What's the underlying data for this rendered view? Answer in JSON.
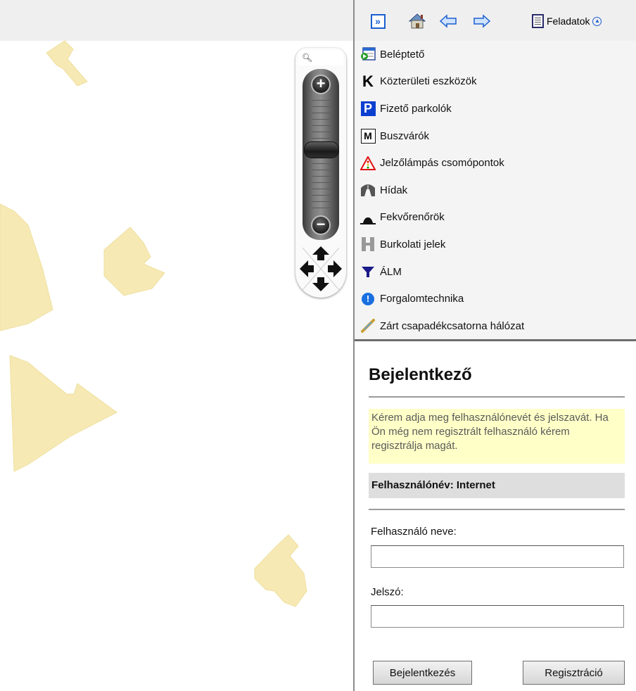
{
  "toolbar": {
    "expand_icon": "expand-double-arrow-icon",
    "home_icon": "home-icon",
    "back_icon": "arrow-left-icon",
    "forward_icon": "arrow-right-icon",
    "tasks_label": "Feladatok",
    "tasks_icon": "document-icon",
    "collapse_icon": "chevron-up-circle-icon"
  },
  "zoom": {
    "search_icon": "magnifier-icon",
    "zoom_in_icon": "plus-icon",
    "zoom_out_icon": "minus-icon",
    "level": 0.58
  },
  "layers": [
    {
      "label": "Beléptető",
      "icon": "entry-form-icon"
    },
    {
      "label": "Közterületi eszközök",
      "icon": "letter-k-icon"
    },
    {
      "label": "Fizető parkolók",
      "icon": "parking-icon"
    },
    {
      "label": "Buszvárók",
      "icon": "letter-m-icon"
    },
    {
      "label": "Jelzőlámpás csomópontok",
      "icon": "warning-triangle-icon"
    },
    {
      "label": "Hídak",
      "icon": "bridge-icon"
    },
    {
      "label": "Fekvőrenőrök",
      "icon": "speed-bump-icon"
    },
    {
      "label": "Burkolati jelek",
      "icon": "letter-h-icon"
    },
    {
      "label": "ÁLM",
      "icon": "funnel-icon"
    },
    {
      "label": "Forgalomtechnika",
      "icon": "info-icon"
    },
    {
      "label": "Zárt csapadékcsatorna hálózat",
      "icon": "pipe-icon"
    }
  ],
  "login": {
    "title": "Bejelentkező",
    "info": "Kérem adja meg felhasználónevét és jelszavát. Ha Ön még nem regisztrált felhasználó kérem regisztrálja magát.",
    "current_user": "Felhasználónév: Internet",
    "username_label": "Felhasználó neve:",
    "username_value": "",
    "password_label": "Jelszó:",
    "password_value": "",
    "login_button": "Bejelentkezés",
    "register_button": "Regisztráció"
  },
  "colors": {
    "parcel_fill": "#f6e9b4",
    "accent_blue": "#1a5fd0",
    "info_bg": "#ffffc8"
  }
}
